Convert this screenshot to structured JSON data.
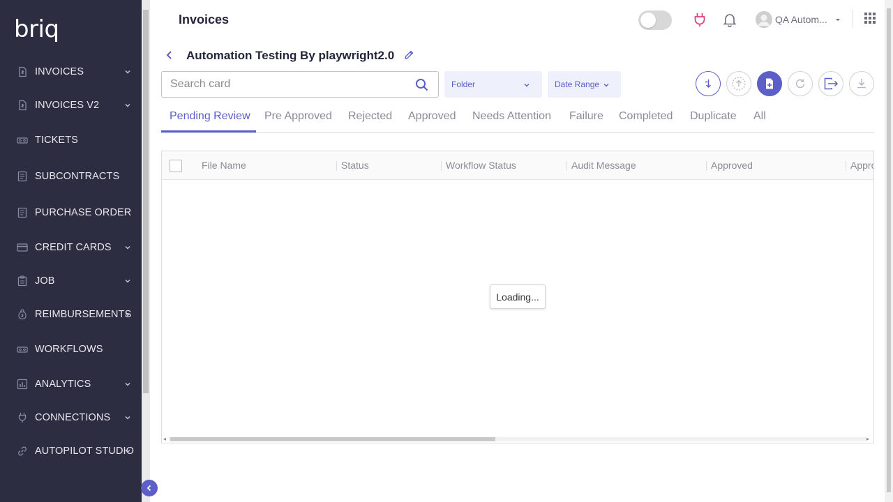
{
  "app": {
    "logo": "briq"
  },
  "sidebar": {
    "items": [
      {
        "label": "INVOICES",
        "icon": "invoice-icon",
        "expandable": true
      },
      {
        "label": "INVOICES V2",
        "icon": "invoice-icon",
        "expandable": true
      },
      {
        "label": "TICKETS",
        "icon": "tickets-icon",
        "expandable": false
      },
      {
        "label": "SUBCONTRACTS",
        "icon": "subcontracts-icon",
        "expandable": false
      },
      {
        "label": "PURCHASE ORDER",
        "icon": "purchase-order-icon",
        "expandable": false
      },
      {
        "label": "CREDIT CARDS",
        "icon": "credit-card-icon",
        "expandable": true
      },
      {
        "label": "JOB",
        "icon": "clipboard-icon",
        "expandable": true
      },
      {
        "label": "REIMBURSEMENTS",
        "icon": "money-bag-icon",
        "expandable": true
      },
      {
        "label": "WORKFLOWS",
        "icon": "workflows-icon",
        "expandable": false
      },
      {
        "label": "ANALYTICS",
        "icon": "analytics-icon",
        "expandable": true
      },
      {
        "label": "CONNECTIONS",
        "icon": "plug-icon",
        "expandable": true
      },
      {
        "label": "AUTOPILOT STUDIO",
        "icon": "link-icon",
        "expandable": true
      }
    ]
  },
  "header": {
    "page_heading": "Invoices",
    "user_name": "QA Autom...",
    "toggle_on": false
  },
  "workspace": {
    "title": "Automation Testing By playwright2.0"
  },
  "toolbar": {
    "search_placeholder": "Search card",
    "folder_label": "Folder",
    "date_range_label": "Date Range"
  },
  "tabs": [
    "Pending Review",
    "Pre Approved",
    "Rejected",
    "Approved",
    "Needs Attention",
    "Failure",
    "Completed",
    "Duplicate",
    "All"
  ],
  "active_tab": "Pending Review",
  "grid": {
    "columns": [
      "File Name",
      "Status",
      "Workflow Status",
      "Audit Message",
      "Approved",
      "Appro"
    ],
    "loading_text": "Loading..."
  },
  "colors": {
    "sidebar_bg": "#2c2d40",
    "accent": "#5b5fc7",
    "plug_pink": "#e0407e"
  }
}
